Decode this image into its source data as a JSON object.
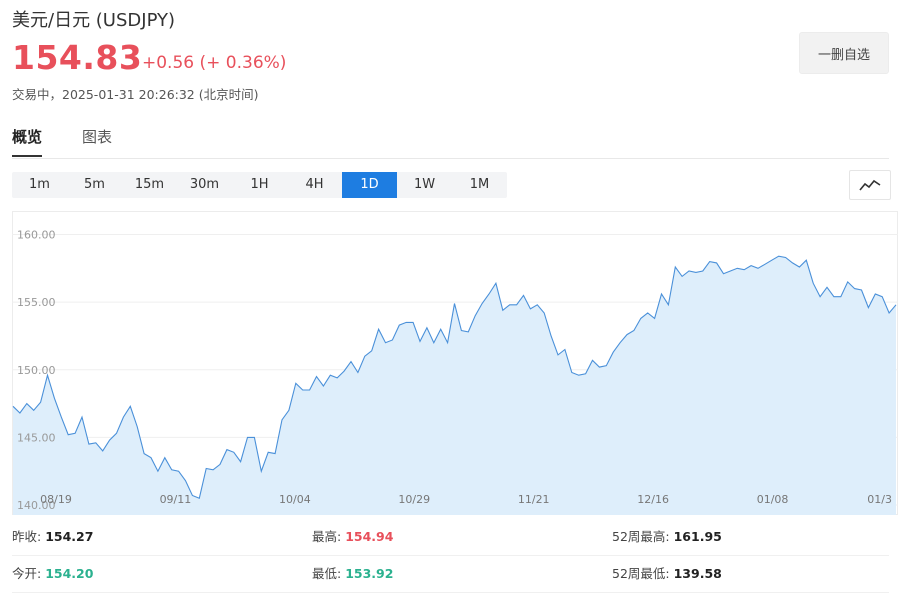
{
  "header": {
    "title": "美元/日元 (USDJPY)",
    "price": "154.83",
    "change": "+0.56 (+ 0.36%)",
    "status": "交易中，2025-01-31 20:26:32 (北京时间)",
    "remove_watchlist_label": "一删自选"
  },
  "tabs": [
    "概览",
    "图表"
  ],
  "periods": [
    "1m",
    "5m",
    "15m",
    "30m",
    "1H",
    "4H",
    "1D",
    "1W",
    "1M"
  ],
  "active_period": "1D",
  "chart_toggle_icon": "line-chart-icon",
  "colors": {
    "up": "#e8505b",
    "down": "#2bb18f",
    "accent": "#1e7de1",
    "line": "#4a90d9",
    "area": "#deeefb"
  },
  "chart_data": {
    "type": "area",
    "ylim": [
      140,
      161
    ],
    "yticks": [
      "160.00",
      "155.00",
      "150.00",
      "145.00",
      "140.00"
    ],
    "xticks": [
      "08/19",
      "09/11",
      "10/04",
      "10/29",
      "11/21",
      "12/16",
      "01/08",
      "01/3"
    ],
    "grid": true,
    "series": [
      {
        "values": [
          147.3,
          146.8,
          147.5,
          147.0,
          147.6,
          149.6,
          147.9,
          146.5,
          145.2,
          145.3,
          146.5,
          144.5,
          144.6,
          144.0,
          144.8,
          145.3,
          146.5,
          147.3,
          145.8,
          143.8,
          143.5,
          142.5,
          143.5,
          142.6,
          142.5,
          141.8,
          140.7,
          140.5,
          142.7,
          142.6,
          143.0,
          144.1,
          143.9,
          143.2,
          145.0,
          145.0,
          142.5,
          143.9,
          143.8,
          146.3,
          147.0,
          149.0,
          148.5,
          148.5,
          149.5,
          148.8,
          149.6,
          149.4,
          149.9,
          150.6,
          149.8,
          151.0,
          151.4,
          153.0,
          152.0,
          152.2,
          153.3,
          153.5,
          153.5,
          152.1,
          153.1,
          152.0,
          153.0,
          152.0,
          154.9,
          152.9,
          152.8,
          154.0,
          154.9,
          155.6,
          156.4,
          154.4,
          154.8,
          154.8,
          155.5,
          154.5,
          154.8,
          154.2,
          152.5,
          151.1,
          151.5,
          149.8,
          149.6,
          149.7,
          150.7,
          150.2,
          150.3,
          151.3,
          152.0,
          152.6,
          152.9,
          153.8,
          154.2,
          153.8,
          155.6,
          154.8,
          157.6,
          156.9,
          157.3,
          157.2,
          157.3,
          158.0,
          157.9,
          157.1,
          157.3,
          157.5,
          157.4,
          157.7,
          157.5,
          157.8,
          158.1,
          158.4,
          158.3,
          157.9,
          157.6,
          158.1,
          156.4,
          155.4,
          156.1,
          155.4,
          155.4,
          156.5,
          156.0,
          155.9,
          154.6,
          155.6,
          155.4,
          154.2,
          154.8
        ]
      }
    ]
  },
  "stats": {
    "prev_close_label": "昨收:",
    "prev_close": "154.27",
    "high_label": "最高:",
    "high": "154.94",
    "high52_label": "52周最高:",
    "high52": "161.95",
    "open_label": "今开:",
    "open": "154.20",
    "low_label": "最低:",
    "low": "153.92",
    "low52_label": "52周最低:",
    "low52": "139.58"
  }
}
